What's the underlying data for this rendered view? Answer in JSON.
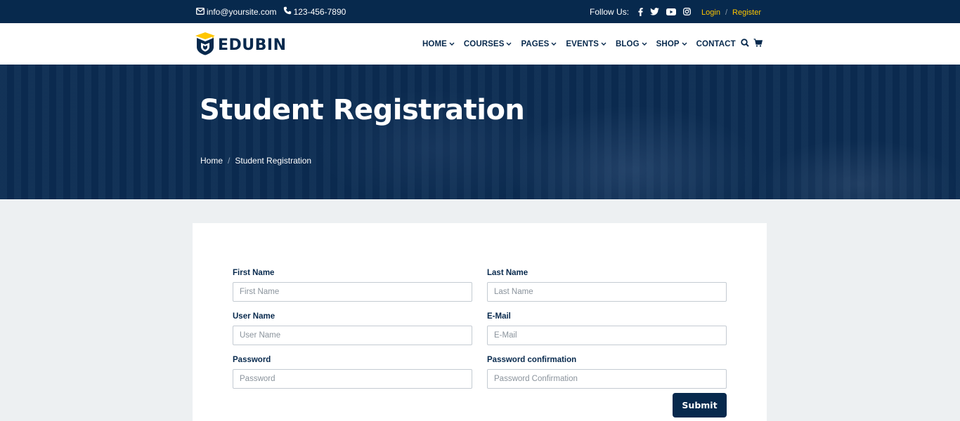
{
  "topbar": {
    "email": "info@yoursite.com",
    "phone": "123-456-7890",
    "follow_label": "Follow Us:",
    "login": "Login",
    "separator": "/",
    "register": "Register"
  },
  "header": {
    "logo_text": "EDUBIN",
    "nav": [
      {
        "label": "HOME",
        "has_dropdown": true
      },
      {
        "label": "COURSES",
        "has_dropdown": true
      },
      {
        "label": "PAGES",
        "has_dropdown": true
      },
      {
        "label": "EVENTS",
        "has_dropdown": true
      },
      {
        "label": "BLOG",
        "has_dropdown": true
      },
      {
        "label": "SHOP",
        "has_dropdown": true
      },
      {
        "label": "CONTACT",
        "has_dropdown": false
      }
    ],
    "chevron": "⌄"
  },
  "banner": {
    "title": "Student Registration",
    "breadcrumb": {
      "home": "Home",
      "sep": "/",
      "current": "Student Registration"
    }
  },
  "form": {
    "first_name": {
      "label": "First Name",
      "placeholder": "First Name"
    },
    "last_name": {
      "label": "Last Name",
      "placeholder": "Last Name"
    },
    "user_name": {
      "label": "User Name",
      "placeholder": "User Name"
    },
    "email": {
      "label": "E-Mail",
      "placeholder": "E-Mail"
    },
    "password": {
      "label": "Password",
      "placeholder": "Password"
    },
    "password_confirmation": {
      "label": "Password confirmation",
      "placeholder": "Password Confirmation"
    },
    "submit": "Submit"
  },
  "colors": {
    "navy": "#07294d",
    "accent": "#ffc600",
    "page_bg": "#edf0f2"
  }
}
